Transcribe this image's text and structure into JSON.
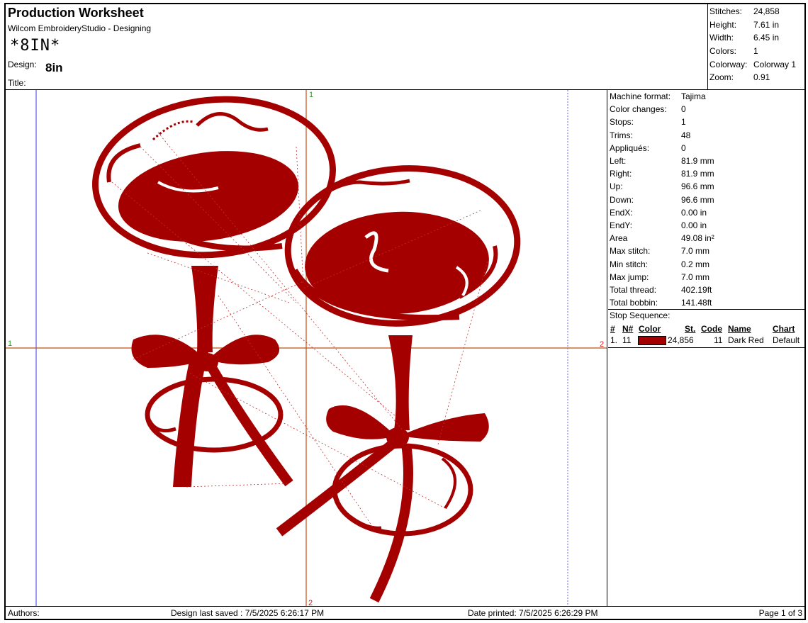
{
  "header": {
    "title": "Production Worksheet",
    "software": "Wilcom EmbroideryStudio - Designing",
    "barcode_text": "*8IN*",
    "design_label": "Design:",
    "design_name": "8in",
    "title_label": "Title:"
  },
  "stats": [
    {
      "label": "Stitches:",
      "value": "24,858"
    },
    {
      "label": "Height:",
      "value": "7.61 in"
    },
    {
      "label": "Width:",
      "value": "6.45 in"
    },
    {
      "label": "Colors:",
      "value": "1"
    },
    {
      "label": "Colorway:",
      "value": "Colorway 1"
    },
    {
      "label": "Zoom:",
      "value": "0.91"
    }
  ],
  "info": [
    {
      "label": "Machine format:",
      "value": "Tajima"
    },
    {
      "label": "Color changes:",
      "value": "0"
    },
    {
      "label": "Stops:",
      "value": "1"
    },
    {
      "label": "Trims:",
      "value": "48"
    },
    {
      "label": "Appliqués:",
      "value": "0"
    },
    {
      "label": "Left:",
      "value": "81.9 mm"
    },
    {
      "label": "Right:",
      "value": "81.9 mm"
    },
    {
      "label": "Up:",
      "value": "96.6 mm"
    },
    {
      "label": "Down:",
      "value": "96.6 mm"
    },
    {
      "label": "EndX:",
      "value": "0.00 in"
    },
    {
      "label": "EndY:",
      "value": "0.00 in"
    },
    {
      "label": "Area",
      "value": " 49.08 in²"
    },
    {
      "label": "Max stitch:",
      "value": "7.0 mm"
    },
    {
      "label": "Min stitch:",
      "value": "0.2 mm"
    },
    {
      "label": "Max jump:",
      "value": "7.0 mm"
    },
    {
      "label": "Total thread:",
      "value": "402.19ft"
    },
    {
      "label": "Total bobbin:",
      "value": "141.48ft"
    }
  ],
  "stop_sequence": {
    "heading": "Stop Sequence:",
    "columns": [
      "#",
      "N#",
      "Color",
      "St.",
      "Code",
      "Name",
      "Chart"
    ],
    "rows": [
      {
        "index": "1.",
        "needle": "11",
        "color": "#a50000",
        "stitches": "24,856",
        "code": "11",
        "name": "Dark Red",
        "chart": "Default"
      }
    ]
  },
  "canvas": {
    "marker_top": "1",
    "marker_bottom": "2",
    "marker_left": "1",
    "marker_right": "2",
    "thread_color": "#a50000"
  },
  "footer": {
    "authors": "Authors:",
    "last_saved": "Design last saved : 7/5/2025 6:26:17 PM",
    "date_printed": "Date printed: 7/5/2025 6:26:29 PM",
    "page": "Page 1 of 3"
  }
}
